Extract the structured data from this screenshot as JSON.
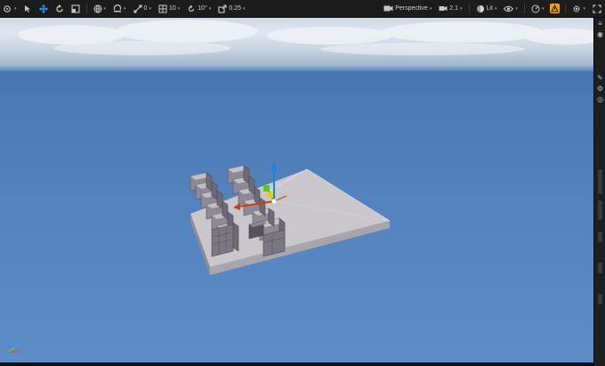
{
  "toolbar": {
    "snap_translate_value": "0",
    "snap_rotate_value": "10",
    "snap_angle_value": "10°",
    "snap_scale_value": "0.25",
    "viewport_type_label": "Perspective",
    "grid_size_value": "2.1",
    "view_mode_label": "Lit",
    "icons": [
      "transform-menu-icon",
      "select-icon",
      "move-icon",
      "rotate-icon",
      "scale-icon",
      "world-local-icon",
      "surface-snap-icon",
      "translate-snap-icon",
      "rotate-snap-icon",
      "scale-snap-icon",
      "camera-icon",
      "view-mode-icon",
      "show-icon",
      "performance-icon",
      "warning-icon",
      "settings-icon",
      "maximize-icon"
    ]
  },
  "colors": {
    "toolbar_bg": "#1c1c1c",
    "accent_blue": "#1ea7ff",
    "warning": "#f0a500",
    "gizmo_x": "#d23a1a",
    "gizmo_y": "#5fbf2a",
    "gizmo_z": "#1f7fe6"
  }
}
